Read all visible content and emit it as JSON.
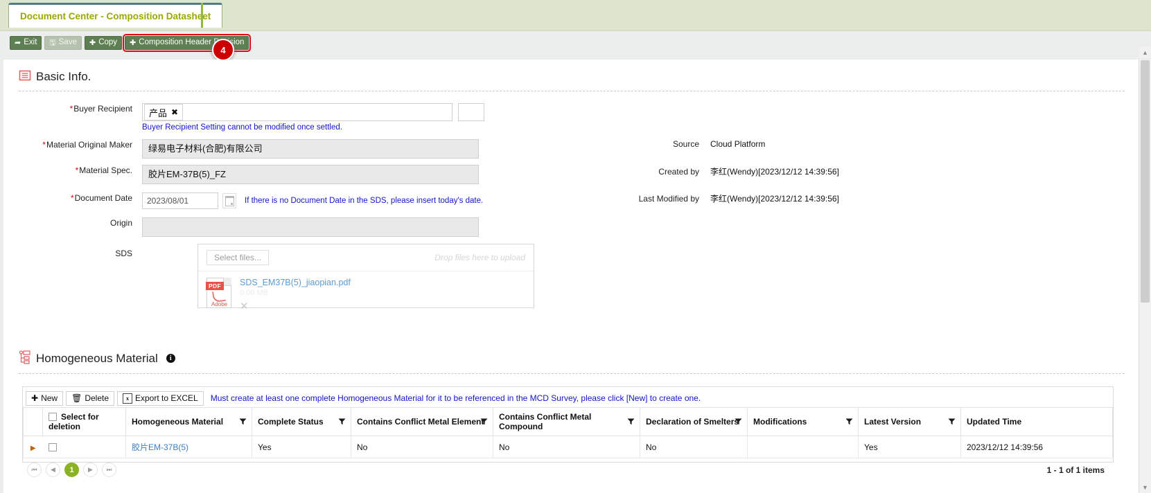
{
  "tab": {
    "label": "Document Center - Composition Datasheet"
  },
  "toolbar": {
    "exit_label": "Exit",
    "save_label": "Save",
    "copy_label": "Copy",
    "revision_label": "Composition Header Revision",
    "step_badge": "4"
  },
  "basic_info": {
    "title": "Basic Info.",
    "buyer_recipient": {
      "label": "Buyer Recipient",
      "required": "*",
      "token": "产品",
      "token_remove": "✖",
      "hint": "Buyer Recipient Setting cannot be modified once settled."
    },
    "material_original_maker": {
      "label": "Material Original Maker",
      "required": "*",
      "value": "绿易电子材料(合肥)有限公司"
    },
    "material_spec": {
      "label": "Material Spec.",
      "required": "*",
      "value": "胶片EM-37B(5)_FZ"
    },
    "document_date": {
      "label": "Document Date",
      "required": "*",
      "value": "2023/08/01",
      "hint": "If there is no Document Date in the SDS, please insert today's date."
    },
    "origin": {
      "label": "Origin",
      "value": ""
    },
    "sds": {
      "label": "SDS",
      "select_files": "Select files...",
      "drop_hint": "Drop files here to upload",
      "file_name": "SDS_EM37B(5)_jiaopian.pdf",
      "file_size": "0.00 MB",
      "file_remove": "✕",
      "file_type_tag": "PDF",
      "file_type_brand": "Adobe"
    },
    "meta": [
      {
        "label": "Source",
        "value": "Cloud Platform"
      },
      {
        "label": "Created by",
        "value": "李红(Wendy)[2023/12/12 14:39:56]"
      },
      {
        "label": "Last Modified by",
        "value": "李红(Wendy)[2023/12/12 14:39:56]"
      }
    ]
  },
  "homogeneous": {
    "title": "Homogeneous Material",
    "info_glyph": "i",
    "tools": {
      "new_label": "New",
      "delete_label": "Delete",
      "export_label": "Export to EXCEL",
      "note": "Must create at least one complete Homogeneous Material for it to be referenced in the MCD Survey, please click [New] to create one."
    },
    "columns": [
      "Select for deletion",
      "Homogeneous Material",
      "Complete Status",
      "Contains Conflict Metal Element",
      "Contains Conflict Metal Compound",
      "Declaration of Smelters",
      "Modifications",
      "Latest Version",
      "Updated Time"
    ],
    "rows": [
      {
        "material": "胶片EM-37B(5)",
        "complete_status": "Yes",
        "conflict_metal_element": "No",
        "conflict_metal_compound": "No",
        "declaration_of_smelters": "No",
        "modifications": "",
        "latest_version": "Yes",
        "updated_time": "2023/12/12 14:39:56"
      }
    ],
    "pager": {
      "first": "⏮",
      "prev": "◀",
      "current": "1",
      "next": "▶",
      "last": "⏭",
      "items": "1 - 1 of 1 items"
    }
  },
  "colors": {
    "tab_text": "#9aa800",
    "button_green": "#5e7f52",
    "highlight_red": "#e30613",
    "hint_blue": "#1414c8",
    "link_blue": "#3f7fbf",
    "pager_green": "#8ab222"
  }
}
